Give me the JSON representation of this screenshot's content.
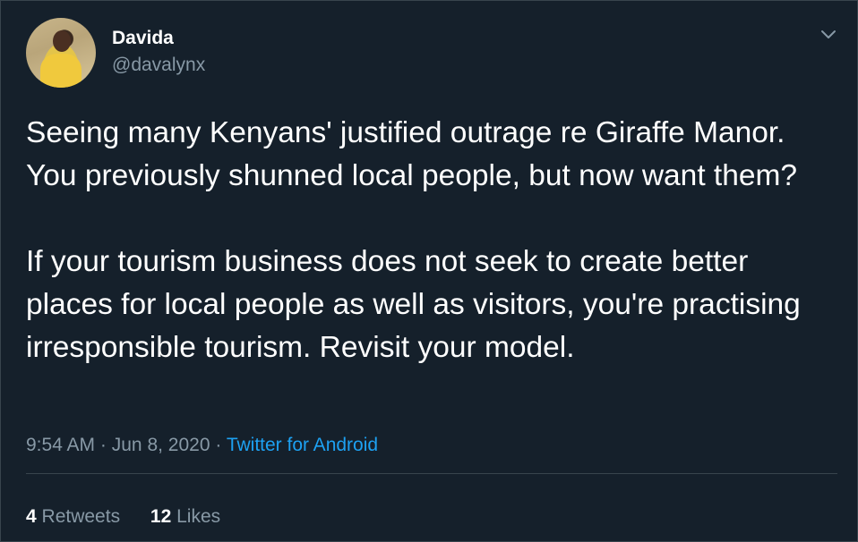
{
  "author": {
    "display_name": "Davida",
    "handle": "@davalynx"
  },
  "tweet": {
    "paragraphs": [
      "Seeing many Kenyans' justified outrage re Giraffe Manor. You previously shunned local people, but now want them?",
      "If your tourism business does not seek to create better places for local people as well as visitors, you're practising irresponsible tourism. Revisit your model."
    ],
    "time": "9:54 AM",
    "separator": "·",
    "date": "Jun 8, 2020",
    "source": "Twitter for Android"
  },
  "stats": {
    "retweets_count": "4",
    "retweets_label": "Retweets",
    "likes_count": "12",
    "likes_label": "Likes"
  },
  "icons": {
    "menu": "chevron-down-icon"
  },
  "colors": {
    "background": "#15202b",
    "secondary_text": "#8899a6",
    "link": "#1da1f2",
    "border": "#38444d"
  }
}
